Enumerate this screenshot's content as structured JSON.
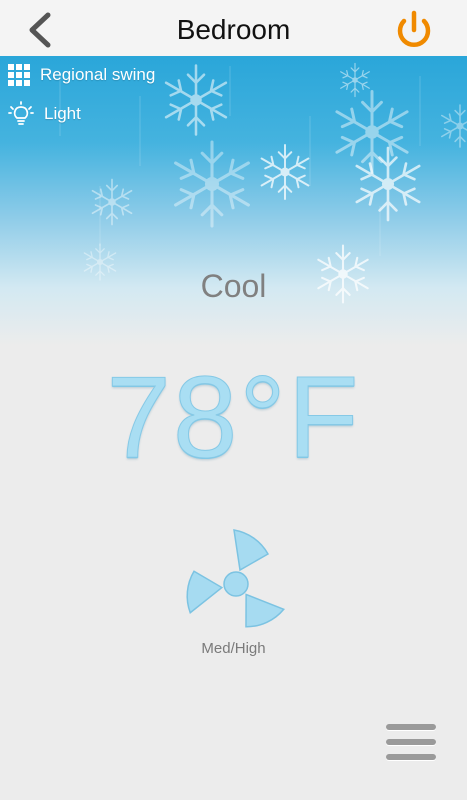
{
  "header": {
    "title": "Bedroom",
    "back_icon": "chevron-left-icon",
    "power_icon": "power-icon",
    "accent_color": "#f08a00"
  },
  "menu": {
    "items": [
      {
        "label": "Regional swing",
        "icon": "grid-icon"
      },
      {
        "label": "Light",
        "icon": "light-bulb-icon"
      }
    ]
  },
  "status": {
    "mode": "Cool",
    "temperature": "78°F",
    "fan_speed": "Med/High"
  },
  "footer": {
    "menu_icon": "hamburger-menu-icon"
  },
  "colors": {
    "sky_top": "#2aa6d9",
    "temperature_text": "#a9def3",
    "fan_blue": "#a6dbf1"
  }
}
